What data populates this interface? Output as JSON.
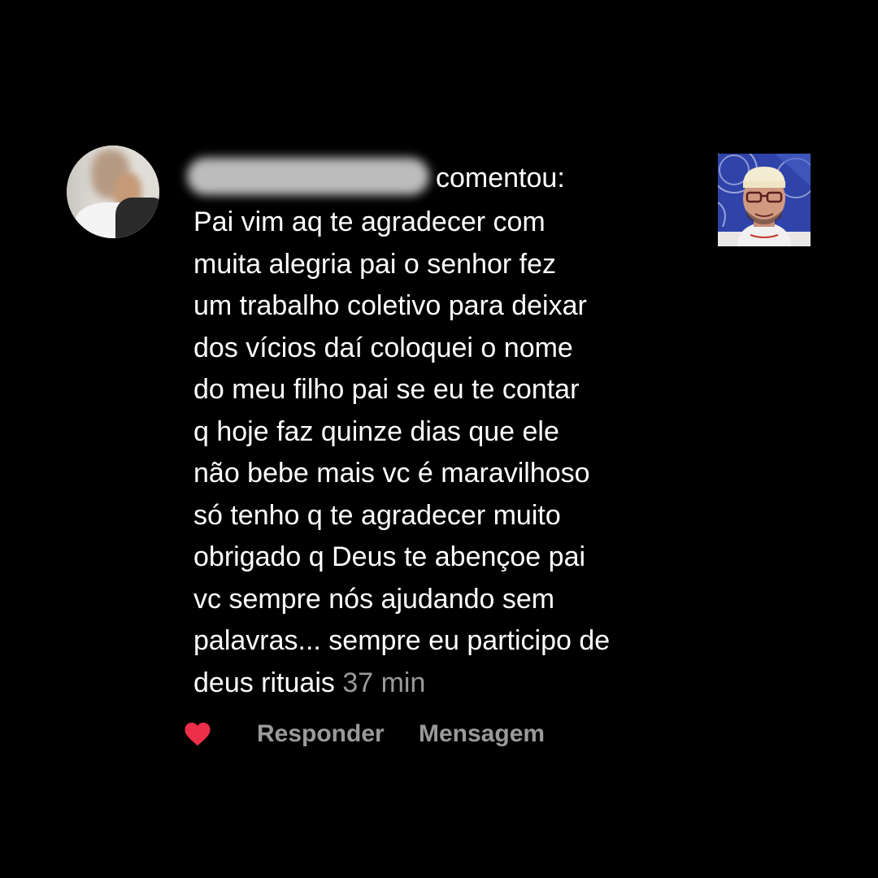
{
  "comment": {
    "action_text": "comentou:",
    "body": "Pai vim aq te agradecer com\nmuita alegria pai o senhor fez\num trabalho coletivo para deixar\ndos vícios daí coloquei o nome\ndo meu filho pai se eu te contar\nq hoje faz quinze dias que ele\nnão bebe mais vc é maravilhoso\nsó tenho q te agradecer muito\nobrigado q Deus te abençoe pai\nvc sempre nós ajudando sem\npalavras... sempre eu participo de\ndeus rituais ",
    "time": "37 min"
  },
  "actions": {
    "like_icon": "heart-icon",
    "reply_label": "Responder",
    "message_label": "Mensagem"
  },
  "colors": {
    "background": "#000000",
    "text": "#ffffff",
    "muted": "#9a9a9a",
    "heart": "#ed2f4a"
  }
}
